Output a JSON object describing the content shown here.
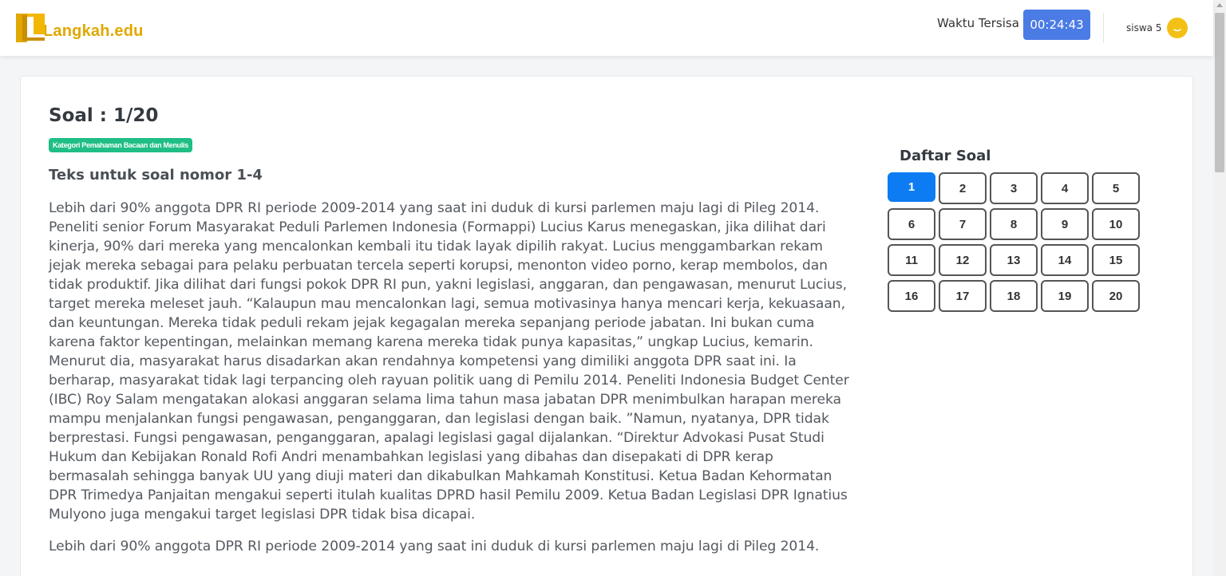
{
  "header": {
    "logo_text": "Langkah.edu",
    "timer_label": "Waktu Tersisa :",
    "timer_value": "00:24:43",
    "user_name": "siswa 5",
    "brand_color": "#e0a800",
    "timer_color": "#4b7be5"
  },
  "question": {
    "title": "Soal : 1/20",
    "category": "Kategori Pemahaman Bacaan dan Menulis",
    "text_heading": "Teks untuk soal nomor 1-4",
    "paragraphs": [
      "Lebih dari 90% anggota DPR RI periode 2009-2014 yang saat ini duduk di kursi parlemen maju lagi di Pileg 2014. Peneliti senior Forum Masyarakat Peduli Parlemen Indonesia (Formappi) Lucius Karus menegaskan, jika dilihat dari kinerja, 90% dari mereka yang mencalonkan kembali itu tidak layak dipilih rakyat. Lucius menggambarkan rekam jejak mereka sebagai para pelaku perbuatan tercela seperti korupsi, menonton video porno, kerap membolos, dan tidak produktif. Jika dilihat dari fungsi pokok DPR RI pun, yakni legislasi, anggaran, dan pengawasan, menurut Lucius, target mereka meleset jauh. “Kalaupun mau mencalonkan lagi, semua motivasinya hanya mencari kerja, kekuasaan, dan keuntungan. Mereka tidak peduli rekam jejak kegagalan mereka sepanjang periode jabatan. Ini bukan cuma karena faktor kepentingan, melainkan memang karena mereka tidak punya kapasitas,” ungkap Lucius, kemarin. Menurut dia, masyarakat harus disadarkan akan rendahnya kompetensi yang dimiliki anggota DPR saat ini. Ia berharap, masyarakat tidak lagi terpancing oleh rayuan politik uang di Pemilu 2014. Peneliti Indonesia Budget Center (IBC) Roy Salam mengatakan alokasi anggaran selama lima tahun masa jabatan DPR menimbulkan harapan mereka mampu menjalankan fungsi pengawasan, penganggaran, dan legislasi dengan baik. ”Namun, nyatanya, DPR tidak berprestasi. Fungsi pengawasan, penganggaran, apalagi legislasi gagal dijalankan. “Direktur Advokasi Pusat Studi Hukum dan Kebijakan Ronald Rofi Andri menambahkan legislasi yang dibahas dan disepakati di DPR kerap bermasalah sehingga banyak UU yang diuji materi dan dikabulkan Mahkamah Konstitusi. Ketua Badan Kehormatan DPR Trimedya Panjaitan mengakui seperti itulah kualitas DPRD hasil Pemilu 2009. Ketua Badan Legislasi DPR Ignatius Mulyono juga mengakui target legislasi DPR tidak bisa dicapai.",
      "Lebih dari 90% anggota DPR RI periode 2009-2014 yang saat ini duduk di kursi parlemen maju lagi di Pileg 2014."
    ]
  },
  "navigator": {
    "title": "Daftar Soal",
    "active": "1",
    "active_color": "#0d7cf2",
    "numbers": [
      "1",
      "2",
      "3",
      "4",
      "5",
      "6",
      "7",
      "8",
      "9",
      "10",
      "11",
      "12",
      "13",
      "14",
      "15",
      "16",
      "17",
      "18",
      "19",
      "20"
    ]
  }
}
